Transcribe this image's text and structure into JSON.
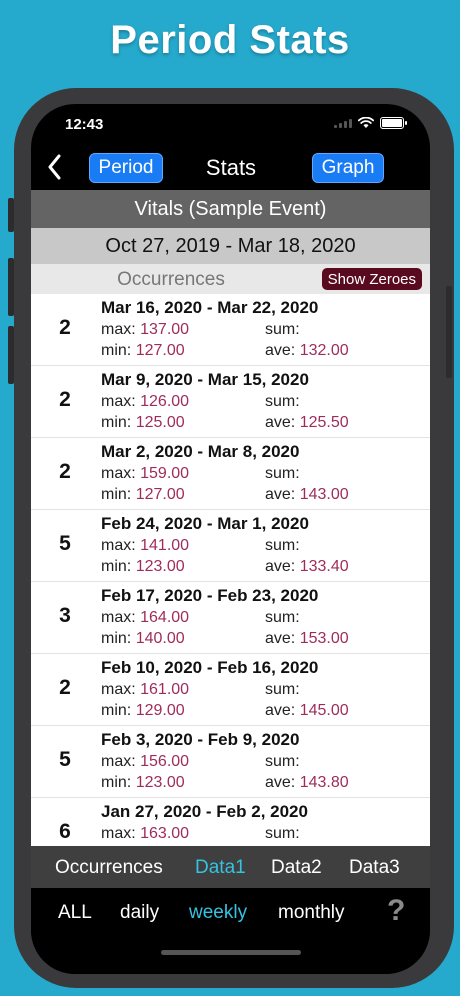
{
  "promo_title": "Period Stats",
  "status": {
    "time": "12:43"
  },
  "nav": {
    "period_label": "Period",
    "title": "Stats",
    "graph_label": "Graph"
  },
  "event_name": "Vitals (Sample Event)",
  "date_range": "Oct 27, 2019 - Mar 18, 2020",
  "section": {
    "title": "Occurrences",
    "show_zeroes": "Show Zeroes"
  },
  "labels": {
    "max": "max:",
    "min": "min:",
    "sum": "sum:",
    "ave": "ave:"
  },
  "rows": [
    {
      "count": "2",
      "range": "Mar 16, 2020 - Mar 22, 2020",
      "max": "137.00",
      "min": "127.00",
      "sum": "",
      "ave": "132.00"
    },
    {
      "count": "2",
      "range": "Mar 9, 2020 - Mar 15, 2020",
      "max": "126.00",
      "min": "125.00",
      "sum": "",
      "ave": "125.50"
    },
    {
      "count": "2",
      "range": "Mar 2, 2020 - Mar 8, 2020",
      "max": "159.00",
      "min": "127.00",
      "sum": "",
      "ave": "143.00"
    },
    {
      "count": "5",
      "range": "Feb 24, 2020 - Mar 1, 2020",
      "max": "141.00",
      "min": "123.00",
      "sum": "",
      "ave": "133.40"
    },
    {
      "count": "3",
      "range": "Feb 17, 2020 - Feb 23, 2020",
      "max": "164.00",
      "min": "140.00",
      "sum": "",
      "ave": "153.00"
    },
    {
      "count": "2",
      "range": "Feb 10, 2020 - Feb 16, 2020",
      "max": "161.00",
      "min": "129.00",
      "sum": "",
      "ave": "145.00"
    },
    {
      "count": "5",
      "range": "Feb 3, 2020 - Feb 9, 2020",
      "max": "156.00",
      "min": "123.00",
      "sum": "",
      "ave": "143.80"
    },
    {
      "count": "6",
      "range": "Jan 27, 2020 - Feb 2, 2020",
      "max": "163.00",
      "min": "",
      "sum": "",
      "ave": ""
    }
  ],
  "data_tabs": [
    "Occurrences",
    "Data1",
    "Data2",
    "Data3"
  ],
  "data_tab_active": "Data1",
  "period_tabs": [
    "ALL",
    "daily",
    "weekly",
    "monthly"
  ],
  "period_tab_active": "weekly",
  "help_glyph": "?",
  "colors": {
    "background": "#25a9cc",
    "accent": "#35c3e0",
    "value": "#9e2c5a",
    "button": "#1a7cf5",
    "zero_button": "#5a0a1e"
  }
}
